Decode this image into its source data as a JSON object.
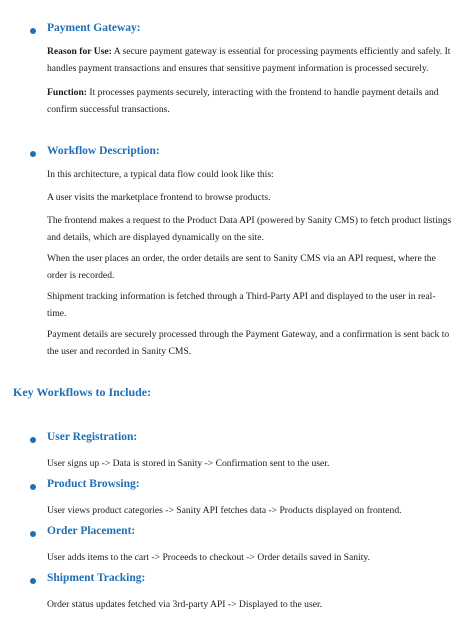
{
  "payment_gateway": {
    "title": "Payment Gateway:",
    "reason_label": "Reason for Use:",
    "reason_text": " A secure payment gateway is essential for processing payments efficiently and safely. It handles payment transactions and ensures that sensitive payment information is processed securely.",
    "function_label": "Function:",
    "function_text": " It processes payments securely, interacting with the frontend to handle payment details and confirm successful transactions."
  },
  "workflow_description": {
    "title": "Workflow Description:",
    "paragraphs": [
      "In this architecture, a typical data flow could look like this:",
      "A user visits the marketplace frontend to browse products.",
      "The frontend makes a request to the Product Data API (powered by Sanity CMS) to fetch product listings and details, which are displayed dynamically on the site.",
      "When the user places an order, the order details are sent to Sanity CMS via an API request, where the order is recorded.",
      "Shipment tracking information is fetched through a Third-Party API and displayed to the user in real-time.",
      "Payment details are securely processed through the Payment Gateway, and a confirmation is sent back to the user and recorded in Sanity CMS."
    ]
  },
  "key_workflows": {
    "heading": "Key Workflows to Include:",
    "items": [
      {
        "title": "User Registration:",
        "text": "User signs up -> Data is stored in Sanity -> Confirmation sent to the user."
      },
      {
        "title": "Product Browsing:",
        "text": "User views product categories -> Sanity API fetches data -> Products displayed on frontend."
      },
      {
        "title": "Order Placement:",
        "text": "User adds items to the cart -> Proceeds to checkout -> Order details saved in Sanity."
      },
      {
        "title": "Shipment Tracking:",
        "text": "Order status updates fetched via 3rd-party API -> Displayed to the user."
      }
    ]
  },
  "colors": {
    "heading_blue": "#1f6fb6",
    "body_text": "#1a1a1a"
  }
}
